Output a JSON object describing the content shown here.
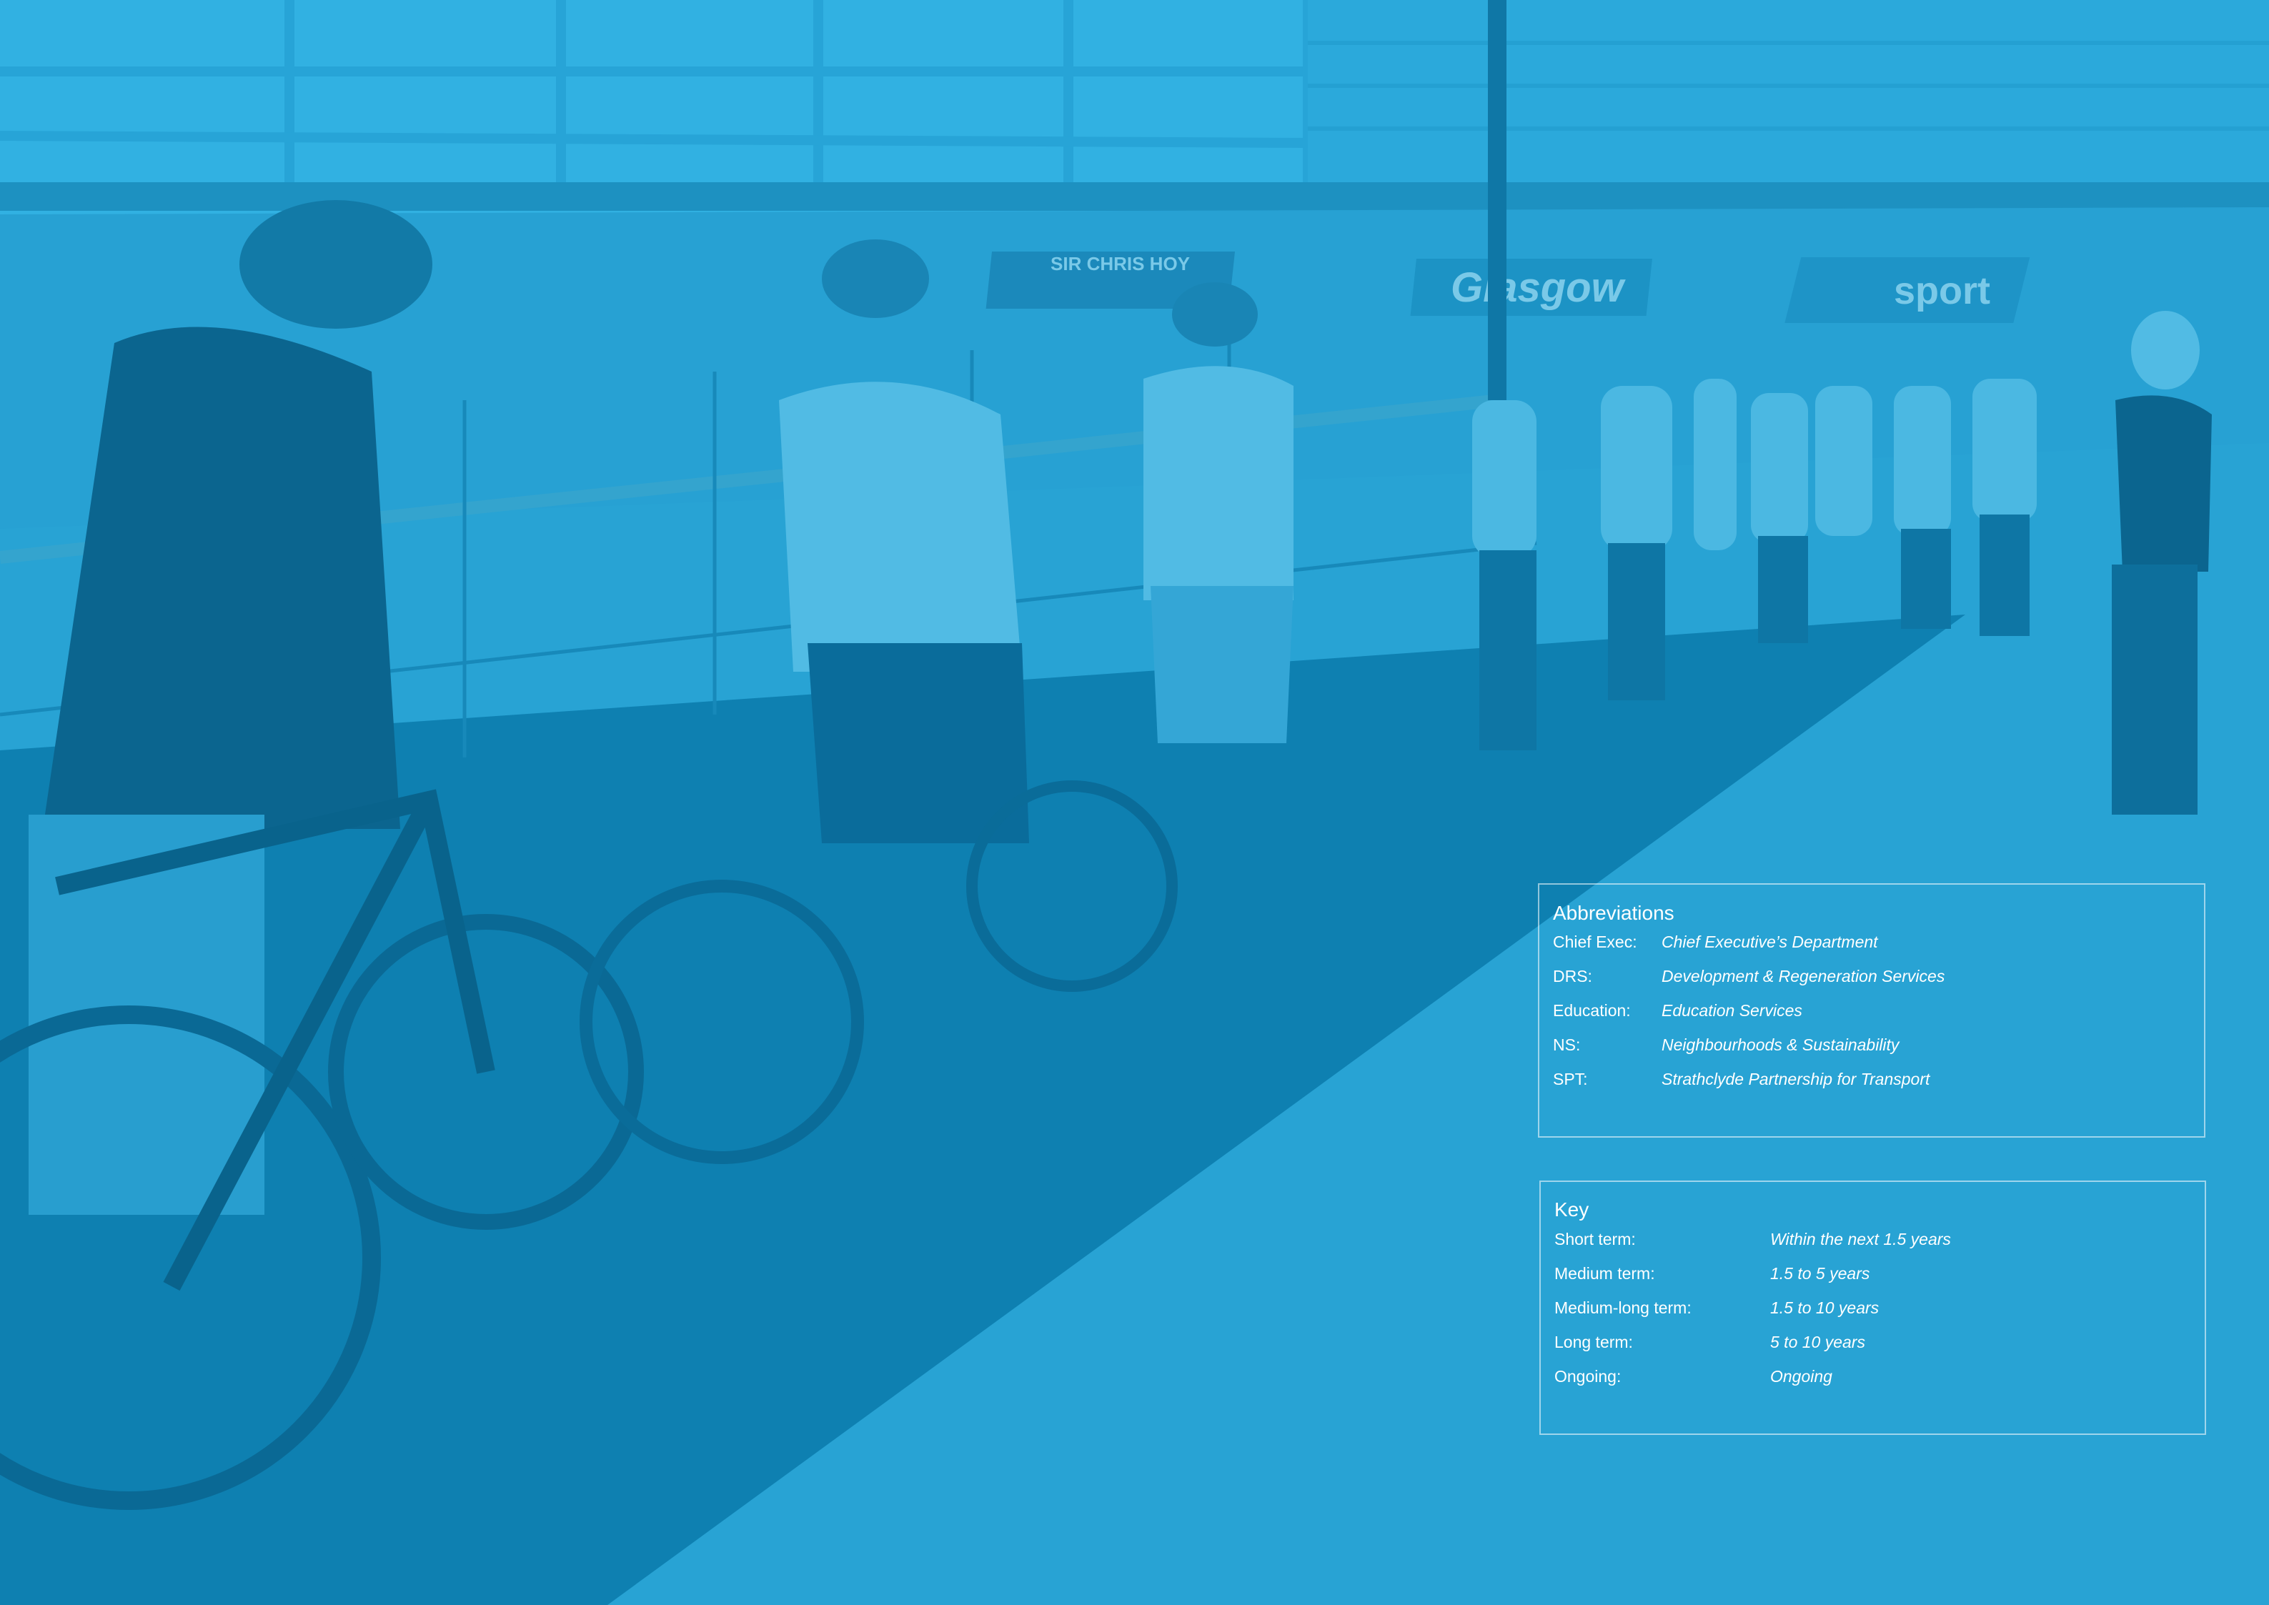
{
  "abbreviations": {
    "title": "Abbreviations",
    "items": [
      {
        "term": "Chief Exec:",
        "meaning": "Chief Executive’s Department"
      },
      {
        "term": "DRS:",
        "meaning": "Development & Regeneration Services"
      },
      {
        "term": "Education:",
        "meaning": "Education Services"
      },
      {
        "term": "NS:",
        "meaning": "Neighbourhoods &  Sustainability"
      },
      {
        "term": "SPT:",
        "meaning": "Strathclyde Partnership for Transport"
      }
    ]
  },
  "key": {
    "title": "Key",
    "items": [
      {
        "term": "Short term:",
        "meaning": "Within the next 1.5 years"
      },
      {
        "term": "Medium term:",
        "meaning": "1.5 to 5 years"
      },
      {
        "term": "Medium-long term:",
        "meaning": "1.5 to 10 years"
      },
      {
        "term": "Long term:",
        "meaning": "5 to 10 years"
      },
      {
        "term": "Ongoing:",
        "meaning": "Ongoing"
      }
    ]
  },
  "background": {
    "signage": {
      "sign_1": "SIR CHRIS HOY",
      "sign_2": "Glasgow",
      "sign_3": "sport"
    },
    "colors": {
      "tint": "#1d9ccf",
      "tint_dark": "#0e86b8",
      "mat": "#0a78a8",
      "text": "#ffffff"
    }
  }
}
